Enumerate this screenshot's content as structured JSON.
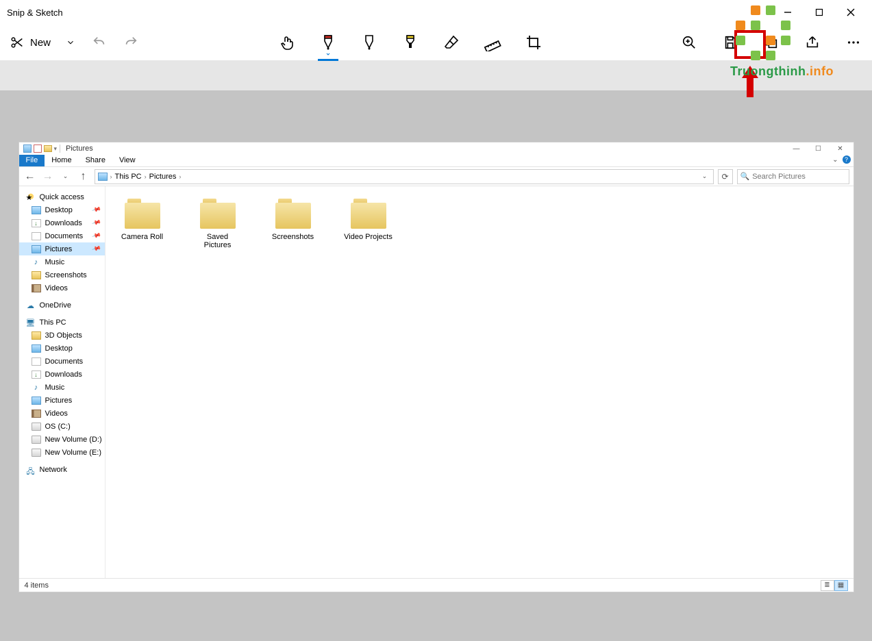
{
  "app": {
    "title": "Snip & Sketch",
    "new_label": "New",
    "tools": {
      "touch_writing": "touch-writing-icon",
      "ballpoint": "ballpoint-pen-icon",
      "pencil": "pencil-icon",
      "highlighter": "highlighter-icon",
      "eraser": "eraser-icon",
      "ruler": "ruler-icon",
      "crop": "crop-icon",
      "zoom": "zoom-icon",
      "save": "save-icon",
      "copy": "copy-icon",
      "share": "share-icon",
      "more": "more-icon"
    }
  },
  "explorer": {
    "window_title": "Pictures",
    "ribbon": {
      "file": "File",
      "home": "Home",
      "share": "Share",
      "view": "View"
    },
    "breadcrumb": {
      "root": "This PC",
      "current": "Pictures"
    },
    "search_placeholder": "Search Pictures",
    "nav": {
      "quick_access": "Quick access",
      "desktop": "Desktop",
      "downloads": "Downloads",
      "documents": "Documents",
      "pictures": "Pictures",
      "music": "Music",
      "screenshots": "Screenshots",
      "videos": "Videos",
      "onedrive": "OneDrive",
      "this_pc": "This PC",
      "pc_3d": "3D Objects",
      "pc_desktop": "Desktop",
      "pc_documents": "Documents",
      "pc_downloads": "Downloads",
      "pc_music": "Music",
      "pc_pictures": "Pictures",
      "pc_videos": "Videos",
      "pc_osc": "OS (C:)",
      "pc_vold": "New Volume (D:)",
      "pc_vole": "New Volume (E:)",
      "network": "Network"
    },
    "folders": [
      {
        "name": "Camera Roll"
      },
      {
        "name": "Saved Pictures"
      },
      {
        "name": "Screenshots"
      },
      {
        "name": "Video Projects"
      }
    ],
    "status": "4 items"
  },
  "watermark": {
    "a": "Truongthinh",
    "b": ".info"
  }
}
